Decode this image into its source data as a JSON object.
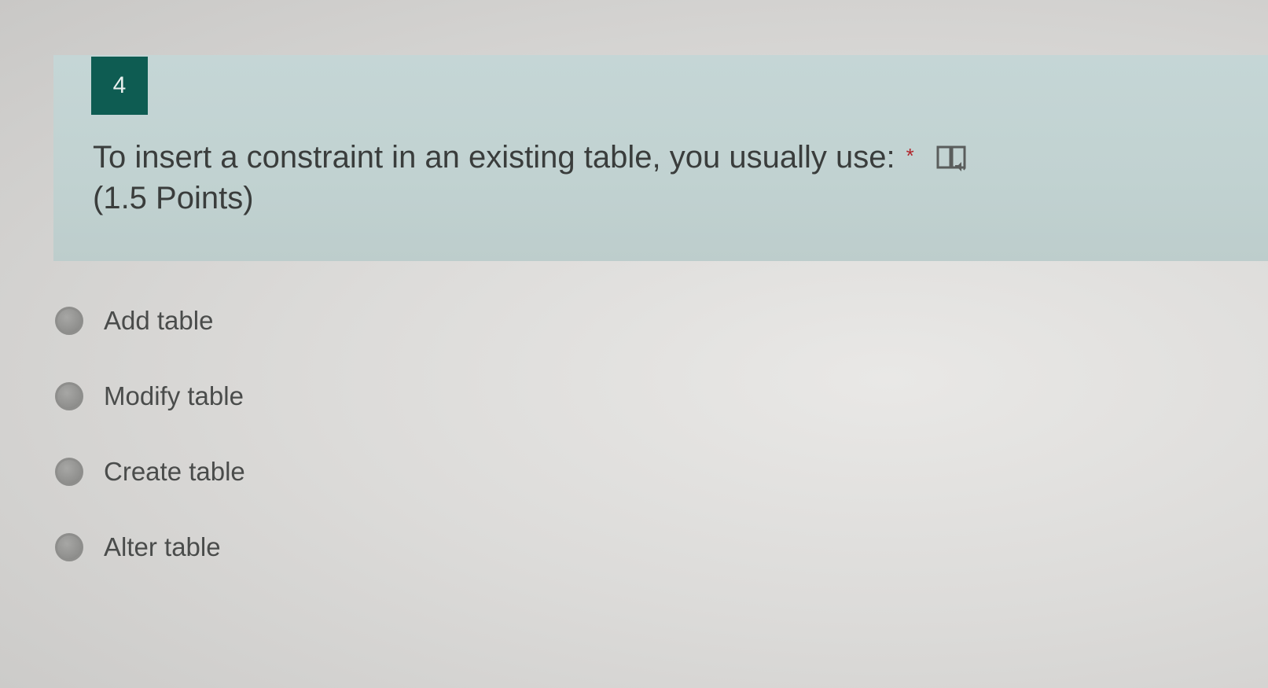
{
  "question": {
    "number": "4",
    "text": "To insert a constraint in an existing table, you usually use:",
    "required_marker": "*",
    "points": "(1.5 Points)",
    "reader_icon": "immersive-reader-icon"
  },
  "options": [
    {
      "label": "Add table"
    },
    {
      "label": "Modify table"
    },
    {
      "label": "Create table"
    },
    {
      "label": "Alter table"
    }
  ],
  "colors": {
    "number_badge": "#0e5c52",
    "header_band": "#c5d6d6",
    "required_marker": "#b0262c"
  }
}
